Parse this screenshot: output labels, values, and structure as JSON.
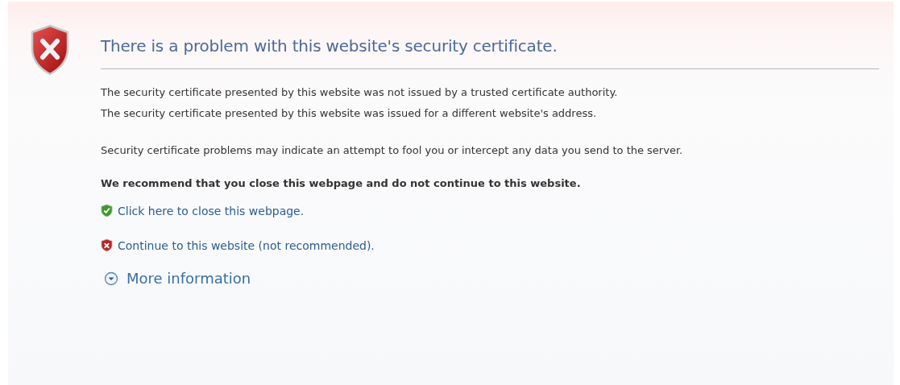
{
  "title": "There is a problem with this website's security certificate.",
  "paragraphs": [
    [
      "The security certificate presented by this website was not issued by a trusted certificate authority.",
      "The security certificate presented by this website was issued for a different website's address."
    ],
    [
      "Security certificate problems may indicate an attempt to fool you or intercept any data you send to the server."
    ]
  ],
  "recommendation": "We recommend that you close this webpage and do not continue to this website.",
  "links": [
    {
      "kind": "safe",
      "label": "Click here to close this webpage."
    },
    {
      "kind": "unsafe",
      "label": "Continue to this website (not recommended)."
    }
  ],
  "more_info": {
    "label": "More information",
    "expanded": false
  }
}
